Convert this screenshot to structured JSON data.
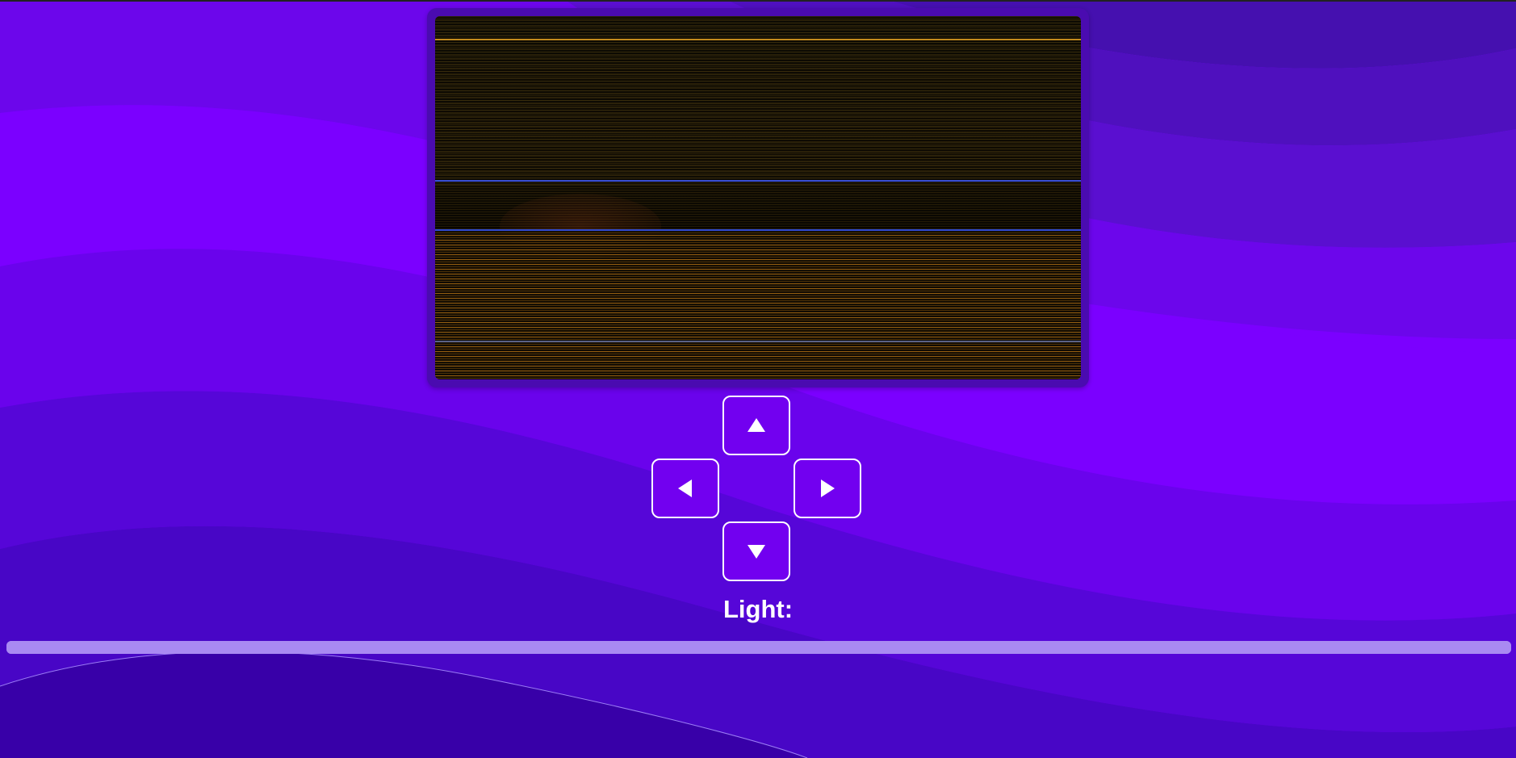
{
  "controls": {
    "up_icon": "arrow-up-icon",
    "left_icon": "arrow-left-icon",
    "right_icon": "arrow-right-icon",
    "down_icon": "arrow-down-icon"
  },
  "light": {
    "label": "Light:",
    "level": 1.0
  },
  "colors": {
    "background": "#7b00ff",
    "button_border": "#ffffff",
    "slider": "#a57ef4"
  }
}
